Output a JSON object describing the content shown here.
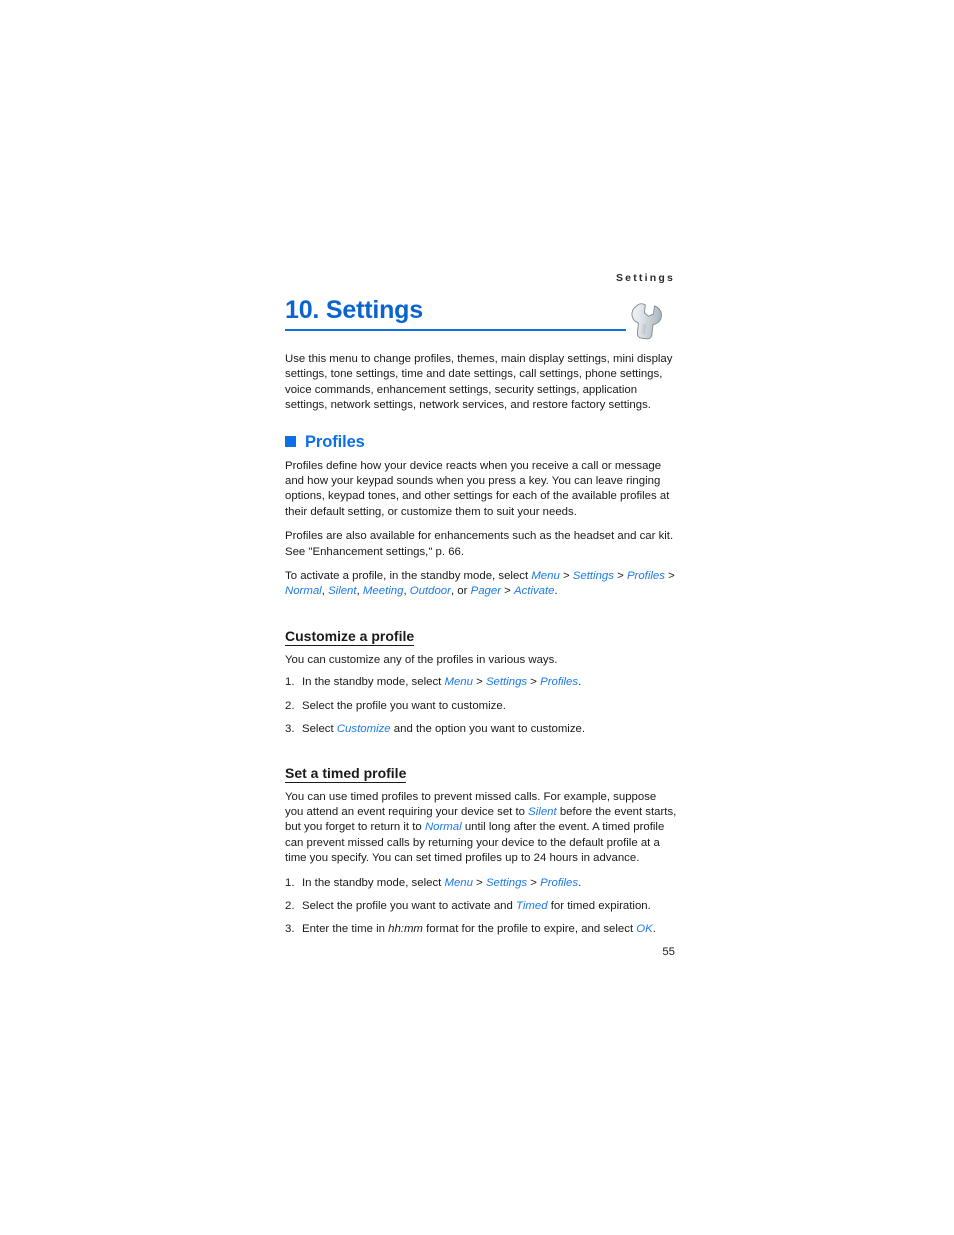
{
  "header": {
    "running_head": "Settings"
  },
  "title": {
    "text": "10. Settings",
    "icon": "wrench-icon",
    "rule_color": "#1271d6",
    "color": "#0a64cd"
  },
  "intro": {
    "paragraph": "Use this menu to change profiles, themes, main display settings, mini display settings, tone settings, time and date settings, call settings, phone settings, voice commands, enhancement settings, security settings, application settings, network settings, network services, and restore factory settings."
  },
  "profiles_section": {
    "heading": "Profiles",
    "bullet_color": "#0b6fe8",
    "paragraph_1": "Profiles define how your device reacts when you receive a call or message and how your keypad sounds when you press a key. You can leave ringing options, keypad tones, and other settings for each of the available profiles at their default setting, or customize them to suit your needs.",
    "paragraph_2": "Profiles are also available for enhancements such as the headset and car kit. See \"Enhancement settings,\" p. 66.",
    "activate_line": {
      "lead": "To activate a profile, in the standby mode, select ",
      "path": [
        "Menu",
        "Settings",
        "Profiles"
      ],
      "profiles_list": [
        "Normal",
        "Silent",
        "Meeting",
        "Outdoor",
        "Pager"
      ],
      "or_word": "or",
      "final_item": "Activate",
      "separator": ">",
      "trailing": "."
    }
  },
  "customize_section": {
    "heading": "Customize a profile",
    "intro": "You can customize any of the profiles in various ways.",
    "steps": [
      {
        "num": "1.",
        "lead": "In the standby mode, select ",
        "path": [
          "Menu",
          "Settings",
          "Profiles"
        ],
        "trailing": "."
      },
      {
        "num": "2.",
        "text": "Select the profile you want to customize."
      },
      {
        "num": "3.",
        "lead": "Select ",
        "ui_term": "Customize",
        "trailing": " and the option you want to customize."
      }
    ]
  },
  "timed_section": {
    "heading": "Set a timed profile",
    "paragraph_parts": {
      "p1": "You can use timed profiles to prevent missed calls. For example, suppose you attend an event requiring your device set to ",
      "silent": "Silent",
      "p2": " before the event starts, but you forget to return it to ",
      "normal": "Normal",
      "p3": " until long after the event. A timed profile can prevent missed calls by returning your device to the default profile at a time you specify. You can set timed profiles up to 24 hours in advance."
    },
    "steps": [
      {
        "num": "1.",
        "lead": "In the standby mode, select ",
        "path": [
          "Menu",
          "Settings",
          "Profiles"
        ],
        "trailing": "."
      },
      {
        "num": "2.",
        "lead": "Select the profile you want to activate and ",
        "ui_term": "Timed",
        "trailing": " for timed expiration."
      },
      {
        "num": "3.",
        "lead": "Enter the time in ",
        "em_term": "hh:mm",
        "mid": " format for the profile to expire, and select ",
        "ui_term": "OK",
        "trailing": "."
      }
    ]
  },
  "footer": {
    "page_number": "55"
  }
}
